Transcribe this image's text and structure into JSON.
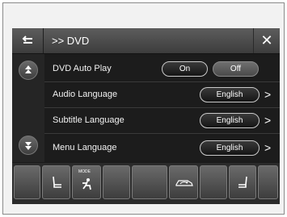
{
  "header": {
    "title": ">> DVD",
    "back_icon": "back-arrow-icon",
    "close_icon": "close-icon",
    "close_glyph": "✕"
  },
  "scroll": {
    "up_icon": "scroll-up-icon",
    "down_icon": "scroll-down-icon"
  },
  "rows": [
    {
      "label": "DVD Auto Play",
      "options": [
        "On",
        "Off"
      ],
      "selected": "Off"
    },
    {
      "label": "Audio Language",
      "value": "English",
      "chevron": ">"
    },
    {
      "label": "Subtitle Language",
      "value": "English",
      "chevron": ">"
    },
    {
      "label": "Menu Language",
      "value": "English",
      "chevron": ">"
    }
  ],
  "bottom_bar": {
    "mode_label": "MODE",
    "icons": [
      "blank",
      "seat-heater-left-icon",
      "fan-mode-icon",
      "blank",
      "blank",
      "recirculation-icon",
      "blank",
      "seat-heater-right-icon",
      "blank"
    ]
  },
  "colors": {
    "screen_bg": "#1b1b1b",
    "header_bg": "#4a4a4a",
    "selected_pill": "#5c5c5c"
  }
}
